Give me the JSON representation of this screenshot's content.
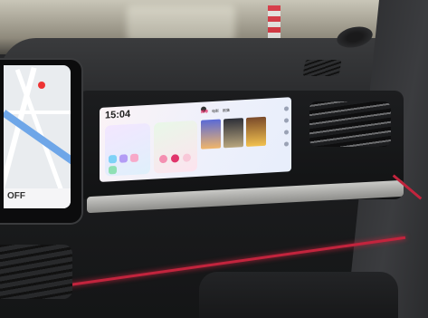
{
  "infotainment": {
    "clock": "15:04",
    "media_tabs": [
      {
        "label": "推荐"
      },
      {
        "label": "电影"
      },
      {
        "label": "剧集"
      }
    ]
  },
  "nav_display": {
    "status_text": "OFF"
  },
  "colors": {
    "accent": "#e0356b",
    "ambient_light": "#c2243d",
    "river": "#6ea6e8"
  }
}
